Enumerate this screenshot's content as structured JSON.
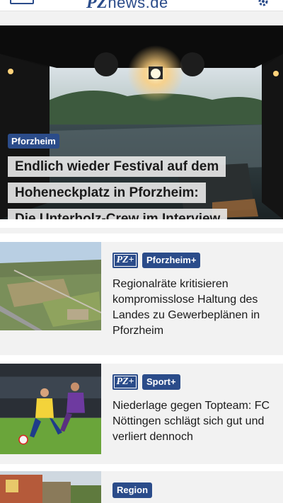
{
  "header": {
    "logo_prefix": "PZ",
    "logo_suffix": "news.de"
  },
  "hero": {
    "tag": "Pforzheim",
    "title_lines": [
      "Endlich wieder Festival auf dem",
      "Hoheneckplatz in Pforzheim:",
      "Die Unterholz-Crew im Interview"
    ]
  },
  "articles": [
    {
      "plus_label": "PZ+",
      "category": "Pforzheim+",
      "title": "Regionalräte kritisieren kompromisslose Haltung des Landes zu Gewerbeplänen in Pforzheim"
    },
    {
      "plus_label": "PZ+",
      "category": "Sport+",
      "title": "Niederlage gegen Topteam: FC Nöttingen schlägt sich gut und verliert dennoch"
    },
    {
      "category": "Region"
    }
  ],
  "colors": {
    "brand": "#2b4c8a",
    "background": "#f2f2f2"
  }
}
